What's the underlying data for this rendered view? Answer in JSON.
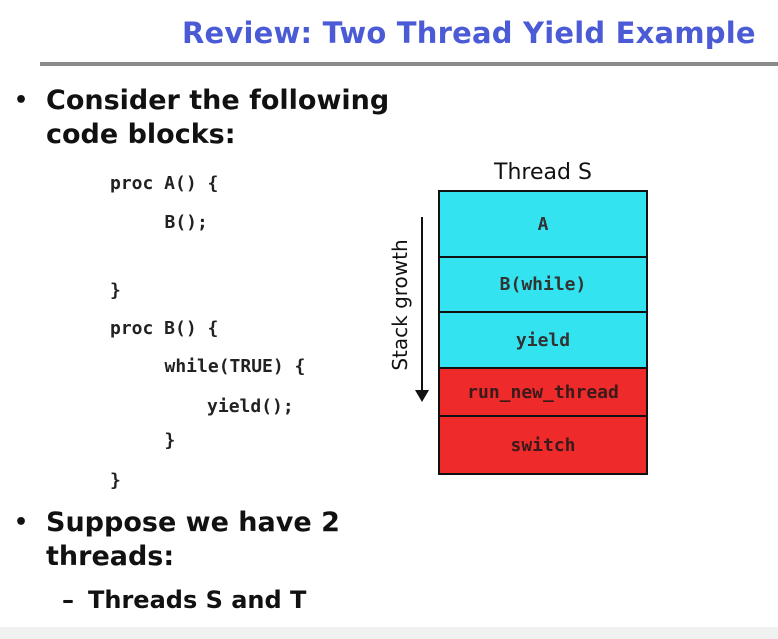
{
  "slide": {
    "title": "Review: Two Thread Yield Example",
    "bullet_symbol": "•",
    "bullet1": [
      "Consider the following",
      "code blocks:"
    ],
    "code_lines": [
      "proc A() {",
      "   B();",
      "}",
      "proc B() {",
      "   while(TRUE) {",
      "      yield();",
      "   }",
      "}"
    ],
    "bullet2": [
      "Suppose we have 2",
      "threads:"
    ],
    "sub_dash": "–",
    "sub_bullet": "Threads S and T"
  },
  "diagram": {
    "stack_title": "Thread S",
    "growth_label": "Stack growth",
    "frames": [
      {
        "label": "A",
        "color": "#33e3f0"
      },
      {
        "label": "B(while)",
        "color": "#33e3f0"
      },
      {
        "label": "yield",
        "color": "#33e3f0"
      },
      {
        "label": "run_new_thread",
        "color": "#ee2a2a"
      },
      {
        "label": "switch",
        "color": "#ee2a2a"
      }
    ]
  },
  "colors": {
    "title": "#4b5bd6",
    "cyan": "#33e3f0",
    "red": "#ee2a2a"
  }
}
